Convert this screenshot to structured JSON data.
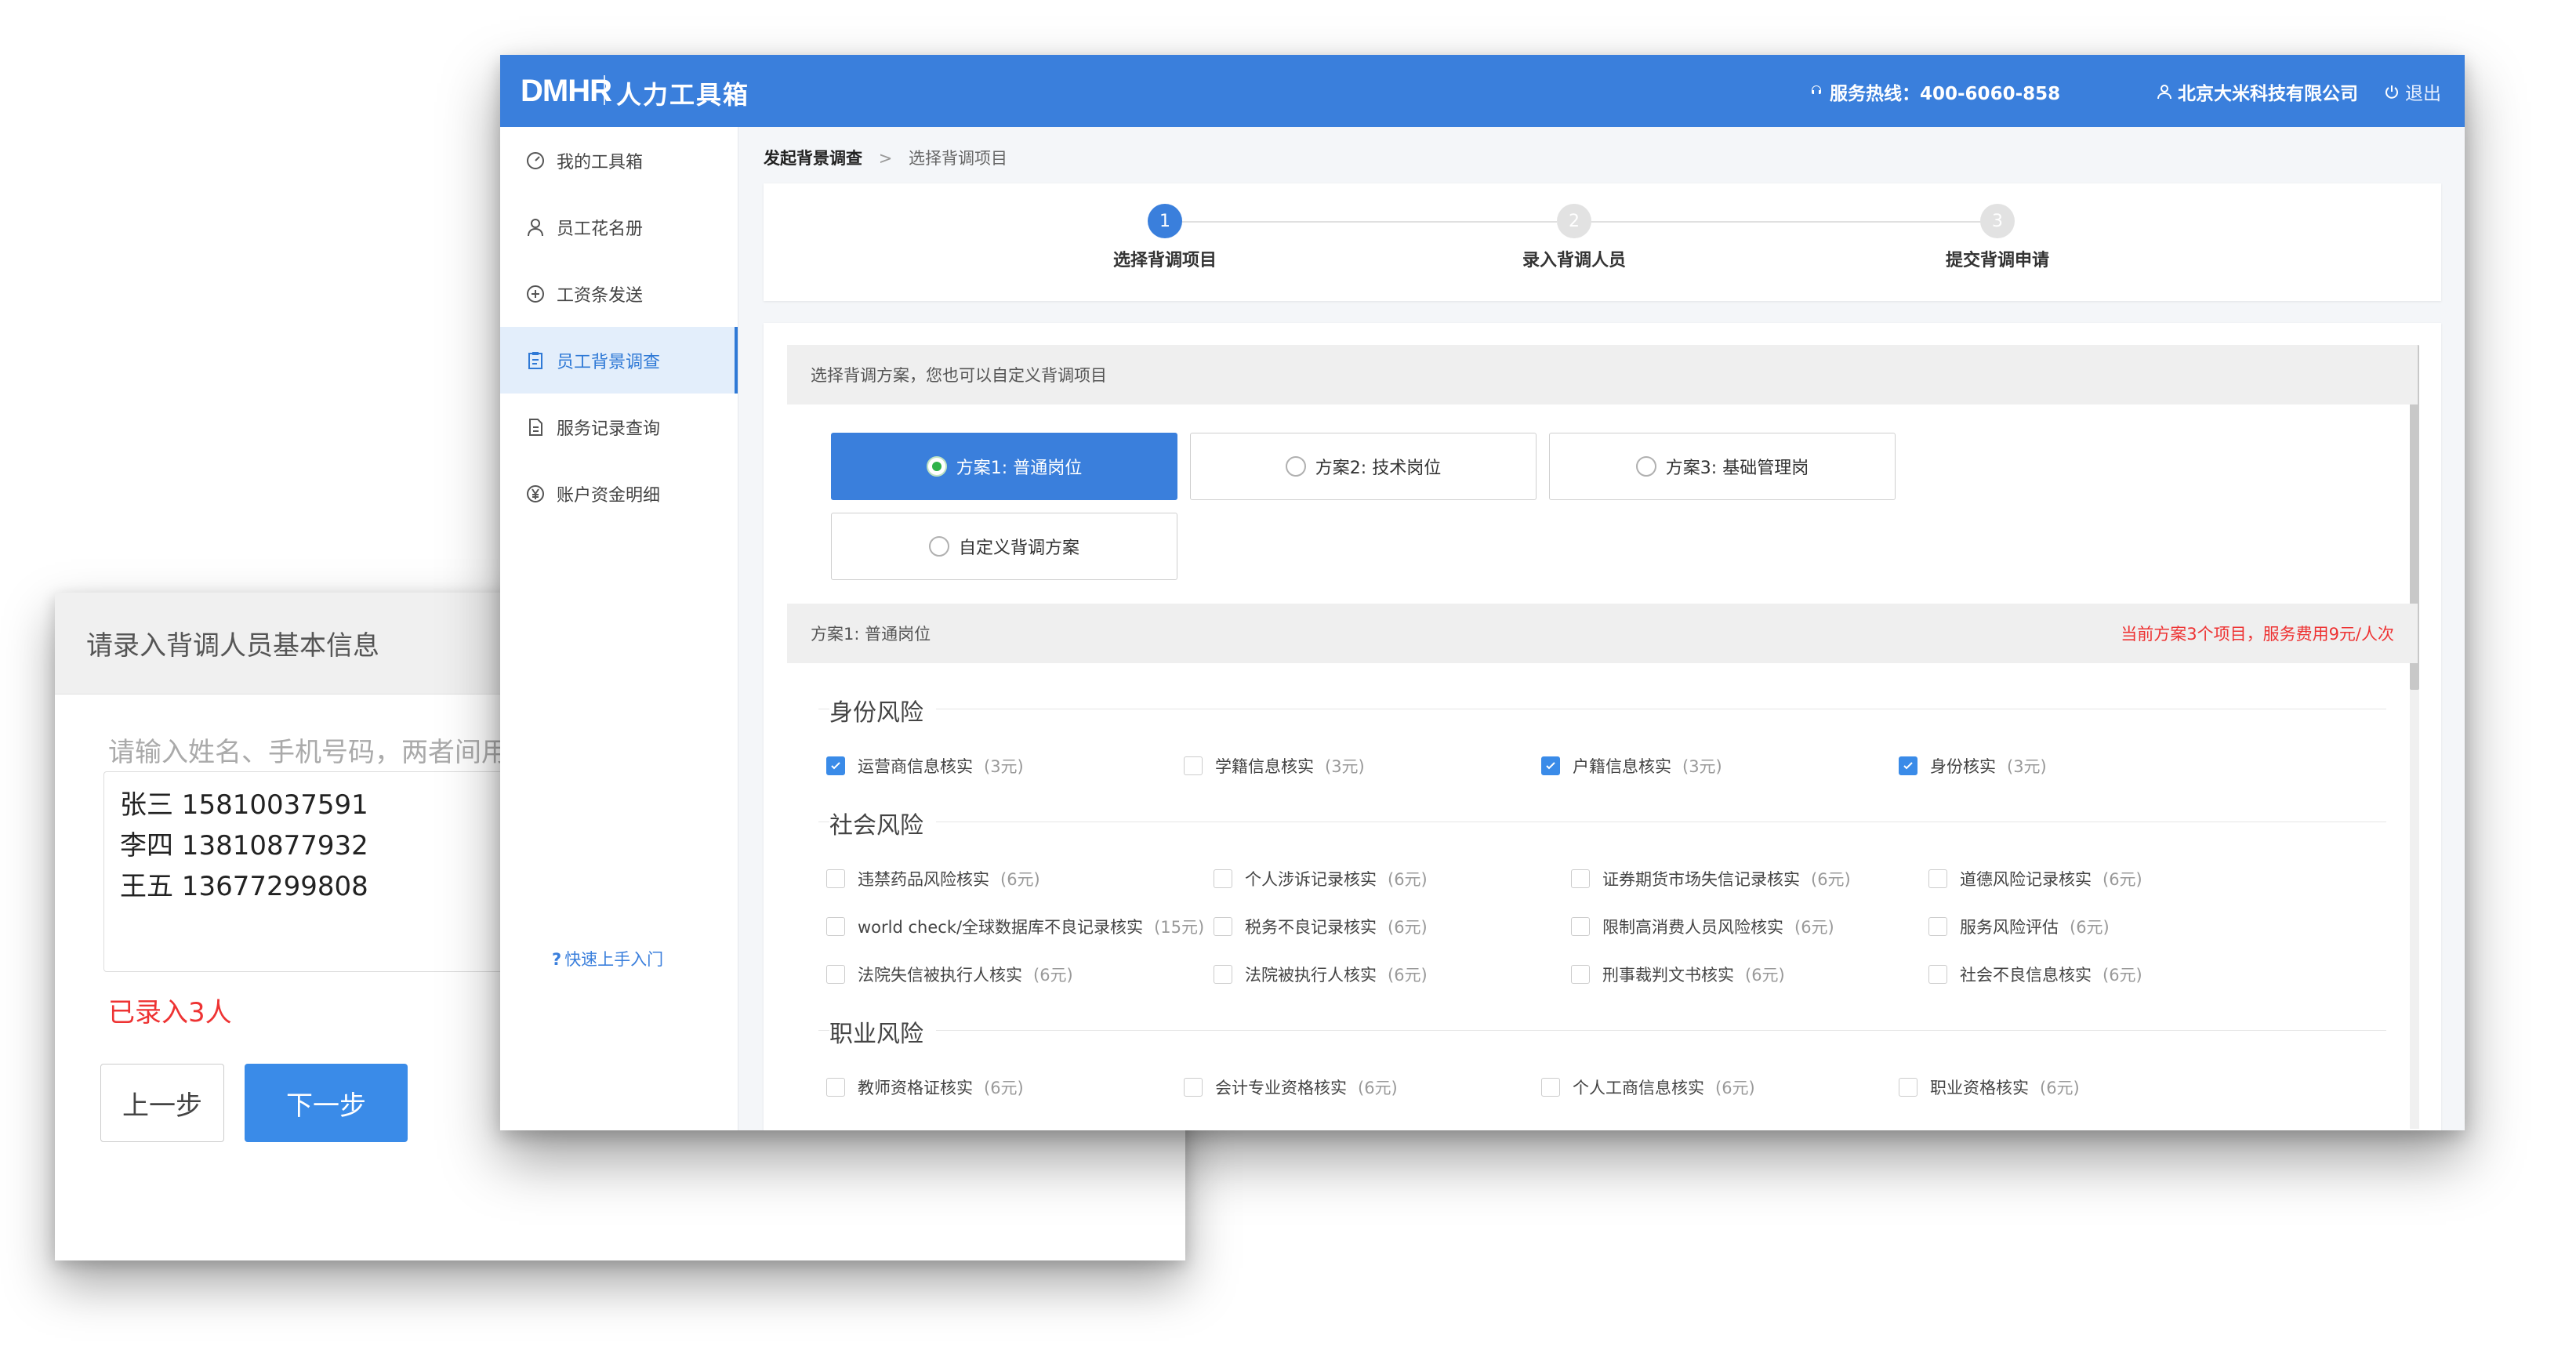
{
  "modal": {
    "title": "请录入背调人员基本信息",
    "placeholder": "请输入姓名、手机号码，两者间用空格分隔",
    "lines": [
      "张三 15810037591",
      "李四 13810877932",
      "王五 13677299808"
    ],
    "count_text": "已录入3人",
    "prev_label": "上一步",
    "next_label": "下一步"
  },
  "header": {
    "logo": "DMHR",
    "app_name": "人力工具箱",
    "hotline": "服务热线：400-6060-858",
    "company": "北京大米科技有限公司",
    "logout": "退出",
    "brand_color": "#3a7fdc"
  },
  "sidebar": {
    "items": [
      {
        "label": "我的工具箱",
        "icon": "gauge-icon"
      },
      {
        "label": "员工花名册",
        "icon": "person-icon"
      },
      {
        "label": "工资条发送",
        "icon": "plus-circle-icon"
      },
      {
        "label": "员工背景调查",
        "icon": "clipboard-icon",
        "active": true
      },
      {
        "label": "服务记录查询",
        "icon": "document-icon"
      },
      {
        "label": "账户资金明细",
        "icon": "yen-icon"
      }
    ],
    "quick_link": "快速上手入门"
  },
  "breadcrumb": {
    "parent": "发起背景调查",
    "separator": ">",
    "current": "选择背调项目"
  },
  "steps": [
    {
      "num": "1",
      "label": "选择背调项目",
      "active": true
    },
    {
      "num": "2",
      "label": "录入背调人员",
      "active": false
    },
    {
      "num": "3",
      "label": "提交背调申请",
      "active": false
    }
  ],
  "plan_section": {
    "header": "选择背调方案，您也可以自定义背调项目",
    "plans": [
      "方案1: 普通岗位",
      "方案2: 技术岗位",
      "方案3: 基础管理岗",
      "自定义背调方案"
    ],
    "selected": "方案1: 普通岗位"
  },
  "summary": {
    "plan": "方案1: 普通岗位",
    "fee": "当前方案3个项目，服务费用9元/人次"
  },
  "categories": [
    {
      "title": "身份风险",
      "items": [
        {
          "label": "运营商信息核实",
          "price": "(3元)",
          "checked": true
        },
        {
          "label": "学籍信息核实",
          "price": "(3元)",
          "checked": false
        },
        {
          "label": "户籍信息核实",
          "price": "(3元)",
          "checked": true
        },
        {
          "label": "身份核实",
          "price": "(3元)",
          "checked": true
        }
      ]
    },
    {
      "title": "社会风险",
      "items": [
        {
          "label": "违禁药品风险核实",
          "price": "(6元)",
          "checked": false
        },
        {
          "label": "个人涉诉记录核实",
          "price": "(6元)",
          "checked": false
        },
        {
          "label": "证券期货市场失信记录核实",
          "price": "(6元)",
          "checked": false
        },
        {
          "label": "道德风险记录核实",
          "price": "(6元)",
          "checked": false
        },
        {
          "label": "world check/全球数据库不良记录核实",
          "price": "(15元)",
          "checked": false
        },
        {
          "label": "税务不良记录核实",
          "price": "(6元)",
          "checked": false
        },
        {
          "label": "限制高消费人员风险核实",
          "price": "(6元)",
          "checked": false
        },
        {
          "label": "服务风险评估",
          "price": "(6元)",
          "checked": false
        },
        {
          "label": "法院失信被执行人核实",
          "price": "(6元)",
          "checked": false
        },
        {
          "label": "法院被执行人核实",
          "price": "(6元)",
          "checked": false
        },
        {
          "label": "刑事裁判文书核实",
          "price": "(6元)",
          "checked": false
        },
        {
          "label": "社会不良信息核实",
          "price": "(6元)",
          "checked": false
        }
      ]
    },
    {
      "title": "职业风险",
      "items": [
        {
          "label": "教师资格证核实",
          "price": "(6元)",
          "checked": false
        },
        {
          "label": "会计专业资格核实",
          "price": "(6元)",
          "checked": false
        },
        {
          "label": "个人工商信息核实",
          "price": "(6元)",
          "checked": false
        },
        {
          "label": "职业资格核实",
          "price": "(6元)",
          "checked": false
        }
      ]
    }
  ]
}
